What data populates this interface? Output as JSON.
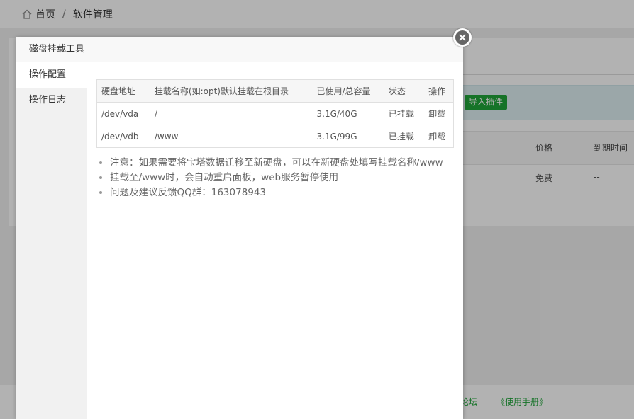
{
  "breadcrumb": {
    "home": "首页",
    "separator": "/",
    "current": "软件管理"
  },
  "background": {
    "import_button": "导入插件",
    "columns": {
      "price": "价格",
      "expire": "到期时间"
    },
    "row": {
      "price": "免费",
      "expire": "--"
    },
    "footer": {
      "forum": "论坛",
      "manual": "《使用手册》"
    }
  },
  "modal": {
    "title": "磁盘挂载工具",
    "sidebar": [
      {
        "label": "操作配置",
        "active": true
      },
      {
        "label": "操作日志",
        "active": false
      }
    ],
    "table": {
      "headers": [
        "硬盘地址",
        "挂载名称(如:opt)默认挂载在根目录",
        "已使用/总容量",
        "状态",
        "操作"
      ],
      "rows": [
        {
          "device": "/dev/vda",
          "mount": "/",
          "usage": "3.1G/40G",
          "status": "已挂载",
          "action": "卸载"
        },
        {
          "device": "/dev/vdb",
          "mount": "/www",
          "usage": "3.1G/99G",
          "status": "已挂载",
          "action": "卸载"
        }
      ]
    },
    "notes": [
      "注意：如果需要将宝塔数据迁移至新硬盘，可以在新硬盘处填写挂载名称/www",
      "挂载至/www时，会自动重启面板，web服务暂停使用",
      "问题及建议反馈QQ群：163078943"
    ]
  },
  "icons": {
    "home": "home-icon",
    "close": "close-icon"
  },
  "colors": {
    "accent": "#20a53a",
    "overlay": "rgba(0,0,0,0.3)"
  }
}
